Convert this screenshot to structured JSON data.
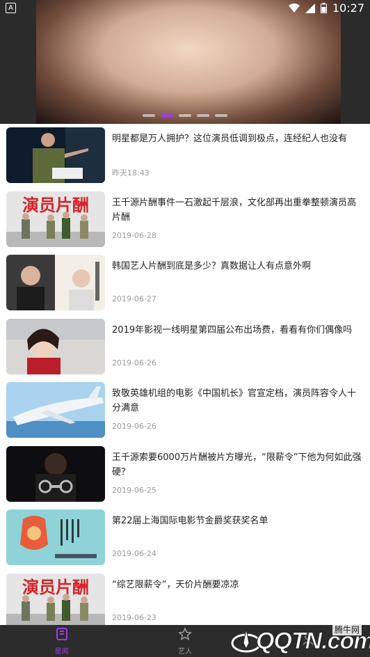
{
  "status": {
    "time": "10:27"
  },
  "banner": {
    "dots": 5,
    "active_dot": 1
  },
  "news": [
    {
      "title": "明星都是万人拥护？这位演员低调到极点，连经纪人也没有",
      "date": "昨天18:43",
      "thumb": "man-speaking"
    },
    {
      "title": "王千源片酬事件一石激起千层浪，文化部再出重拳整顿演员高片酬",
      "date": "2019-06-28",
      "thumb": "actor-fee",
      "thumb_text": "演员片酬"
    },
    {
      "title": "韩国艺人片酬到底是多少？真数据让人有点意外啊",
      "date": "2019-06-27",
      "thumb": "korean-stars"
    },
    {
      "title": "2019年影视一线明星第四届公布出场费，看看有你们偶像吗",
      "date": "2019-06-26",
      "thumb": "actress"
    },
    {
      "title": "致敬英雄机组的电影《中国机长》官宣定档，演员阵容令人十分满意",
      "date": "2019-06-26",
      "thumb": "airplane"
    },
    {
      "title": "王千源索要6000万片酬被片方曝光，“限薪令”下他为何如此强硬？",
      "date": "2019-06-25",
      "thumb": "handcuffs"
    },
    {
      "title": "第22届上海国际电影节金爵奖获奖名单",
      "date": "2019-06-24",
      "thumb": "festival-poster"
    },
    {
      "title": "“综艺限薪令”，天价片酬要凉凉",
      "date": "2019-06-23",
      "thumb": "actor-fee",
      "thumb_text": "演员片酬"
    }
  ],
  "tabs": [
    {
      "label": "星闻",
      "icon": "news-icon",
      "active": true
    },
    {
      "label": "艺人",
      "icon": "star-icon",
      "active": false
    },
    {
      "label": "",
      "icon": "person-icon",
      "active": false
    }
  ],
  "watermark": {
    "text": "QQTN.com",
    "top": "腾牛网"
  },
  "colors": {
    "accent": "#9b3ee6",
    "tabbar": "#2c2c2c"
  }
}
